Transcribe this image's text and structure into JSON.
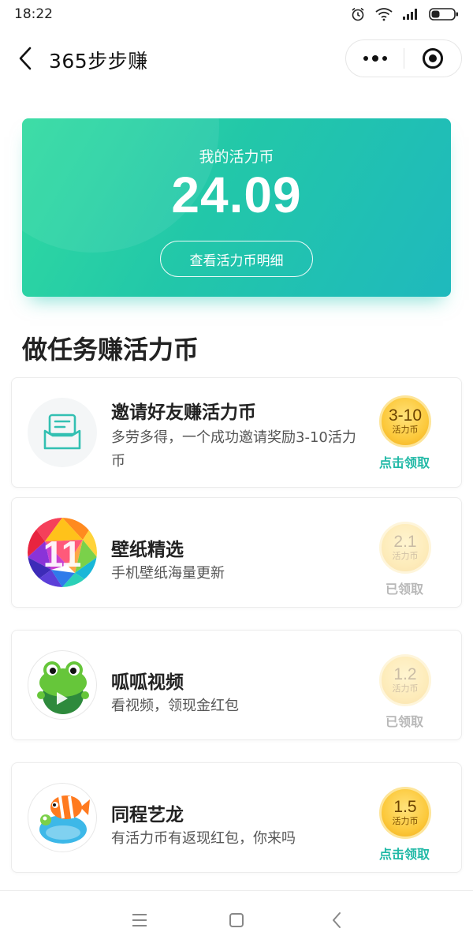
{
  "status_bar": {
    "time": "18:22"
  },
  "nav": {
    "title": "365步步赚"
  },
  "balance": {
    "label": "我的活力币",
    "value": "24.09",
    "detail_button": "查看活力币明细"
  },
  "section_title": "做任务赚活力币",
  "tasks": [
    {
      "title": "邀请好友赚活力币",
      "desc": "多劳多得，一个成功邀请奖励3-10活力币",
      "coin_value": "3-10",
      "coin_unit": "活力币",
      "action": "点击领取",
      "claimed": false,
      "icon": "envelope-icon"
    },
    {
      "title": "壁纸精选",
      "desc": "手机壁纸海量更新",
      "coin_value": "2.1",
      "coin_unit": "活力币",
      "action": "已领取",
      "claimed": true,
      "icon": "wallpaper-app-icon"
    },
    {
      "title": "呱呱视频",
      "desc": "看视频，领现金红包",
      "coin_value": "1.2",
      "coin_unit": "活力币",
      "action": "已领取",
      "claimed": true,
      "icon": "frog-app-icon"
    },
    {
      "title": "同程艺龙",
      "desc": "有活力币有返现红包，你来吗",
      "coin_value": "1.5",
      "coin_unit": "活力币",
      "action": "点击领取",
      "claimed": false,
      "icon": "clownfish-app-icon"
    }
  ],
  "colors": {
    "accent": "#21b9a6",
    "card_gradient_start": "#30dba0",
    "card_gradient_end": "#1fb9bd",
    "coin": "#fcc93c"
  }
}
